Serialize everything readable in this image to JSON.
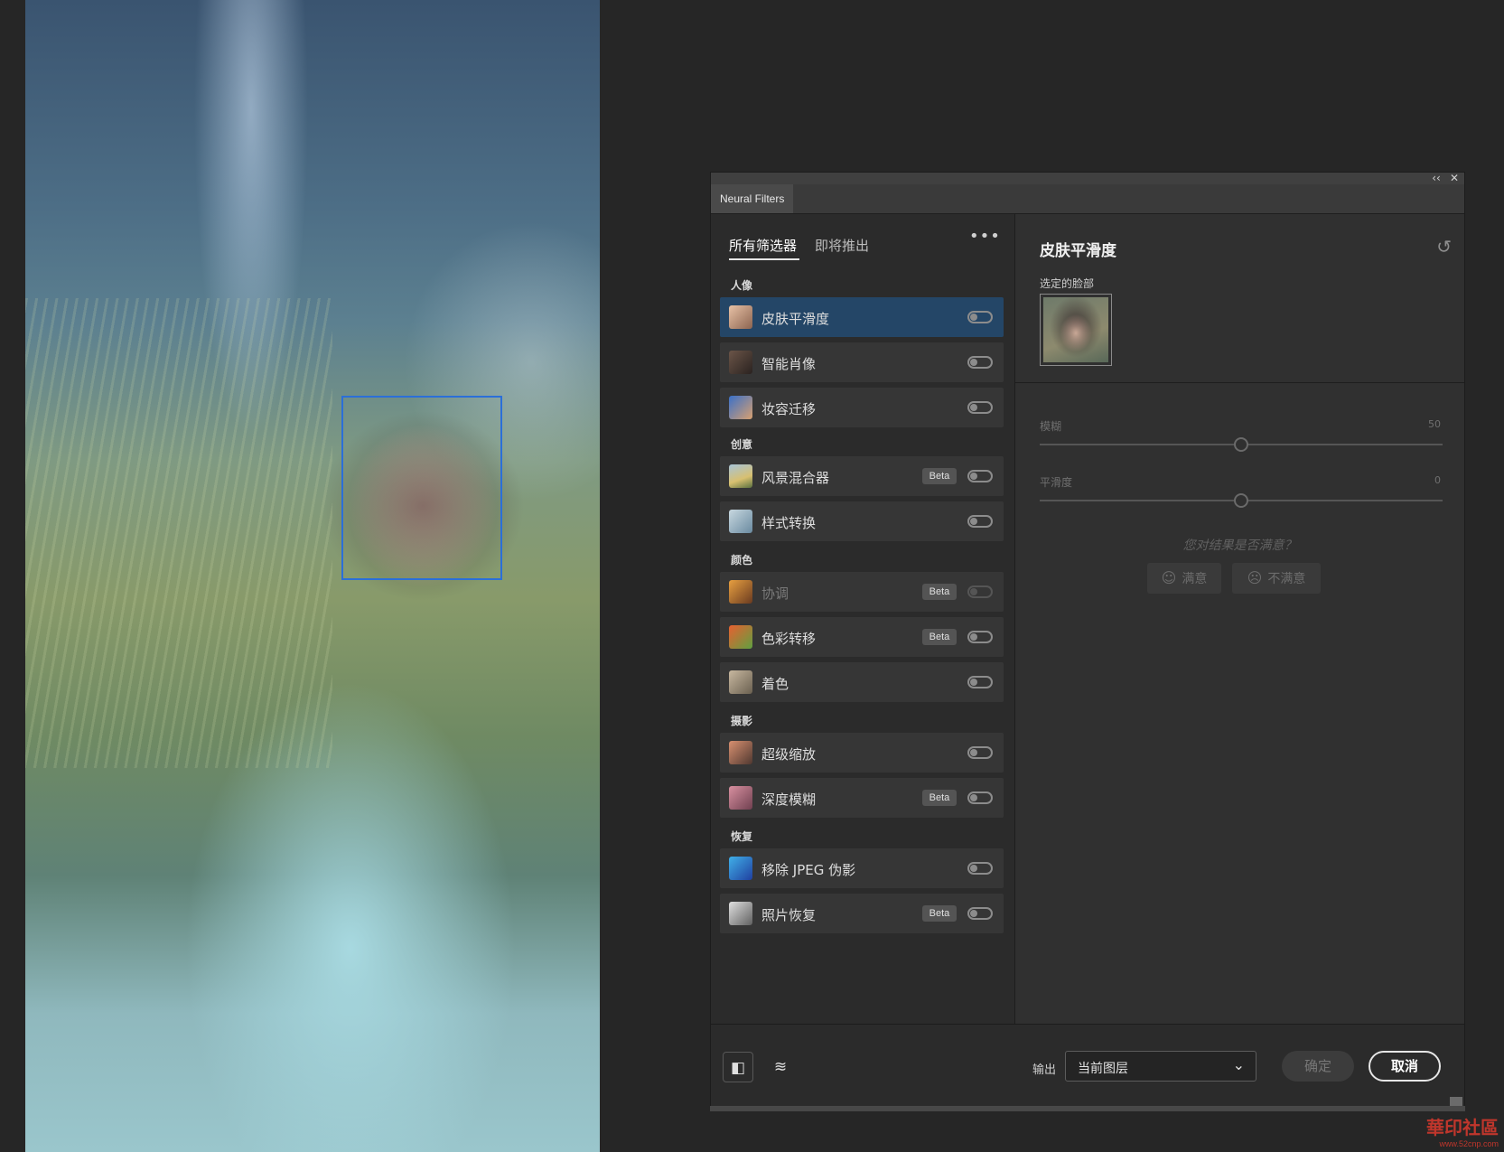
{
  "dialog": {
    "tab_label": "Neural Filters",
    "collapse_glyph": "‹‹",
    "close_glyph": "✕"
  },
  "filters_panel": {
    "tabs": [
      "所有筛选器",
      "即将推出"
    ],
    "more_glyph": "•••",
    "beta_label": "Beta",
    "categories": [
      {
        "label": "人像",
        "items": [
          {
            "name": "皮肤平滑度",
            "beta": false,
            "selected": true,
            "disabled": false,
            "icon": "face-skin-icon"
          },
          {
            "name": "智能肖像",
            "beta": false,
            "selected": false,
            "disabled": false,
            "icon": "portrait-icon"
          },
          {
            "name": "妆容迁移",
            "beta": false,
            "selected": false,
            "disabled": false,
            "icon": "makeup-icon"
          }
        ]
      },
      {
        "label": "创意",
        "items": [
          {
            "name": "风景混合器",
            "beta": true,
            "selected": false,
            "disabled": false,
            "icon": "landscape-icon"
          },
          {
            "name": "样式转换",
            "beta": false,
            "selected": false,
            "disabled": false,
            "icon": "style-transfer-icon"
          }
        ]
      },
      {
        "label": "颜色",
        "items": [
          {
            "name": "协调",
            "beta": true,
            "selected": false,
            "disabled": true,
            "icon": "harmonize-icon"
          },
          {
            "name": "色彩转移",
            "beta": true,
            "selected": false,
            "disabled": false,
            "icon": "color-transfer-icon"
          },
          {
            "name": "着色",
            "beta": false,
            "selected": false,
            "disabled": false,
            "icon": "colorize-icon"
          }
        ]
      },
      {
        "label": "摄影",
        "items": [
          {
            "name": "超级缩放",
            "beta": false,
            "selected": false,
            "disabled": false,
            "icon": "super-zoom-icon"
          },
          {
            "name": "深度模糊",
            "beta": true,
            "selected": false,
            "disabled": false,
            "icon": "depth-blur-icon"
          }
        ]
      },
      {
        "label": "恢复",
        "items": [
          {
            "name": "移除 JPEG 伪影",
            "beta": false,
            "selected": false,
            "disabled": false,
            "icon": "jpeg-artifact-icon"
          },
          {
            "name": "照片恢复",
            "beta": true,
            "selected": false,
            "disabled": false,
            "icon": "photo-restore-icon"
          }
        ]
      }
    ]
  },
  "settings_panel": {
    "title": "皮肤平滑度",
    "selected_face_label": "选定的脸部",
    "sliders": [
      {
        "label": "模糊",
        "value": 50,
        "min": 0,
        "max": 100
      },
      {
        "label": "平滑度",
        "value": 0,
        "min": -50,
        "max": 50
      }
    ],
    "feedback_question": "您对结果是否满意？",
    "satisfied_label": "满意",
    "unsatisfied_label": "不满意"
  },
  "bottom_bar": {
    "output_label": "输出",
    "output_value": "当前图层",
    "ok_label": "确定",
    "cancel_label": "取消"
  },
  "watermark": {
    "text": "華印社區",
    "url": "www.52cnp.com"
  },
  "colors": {
    "selected_item": "#244667",
    "face_box": "#2b6fd8",
    "background": "#262626"
  }
}
